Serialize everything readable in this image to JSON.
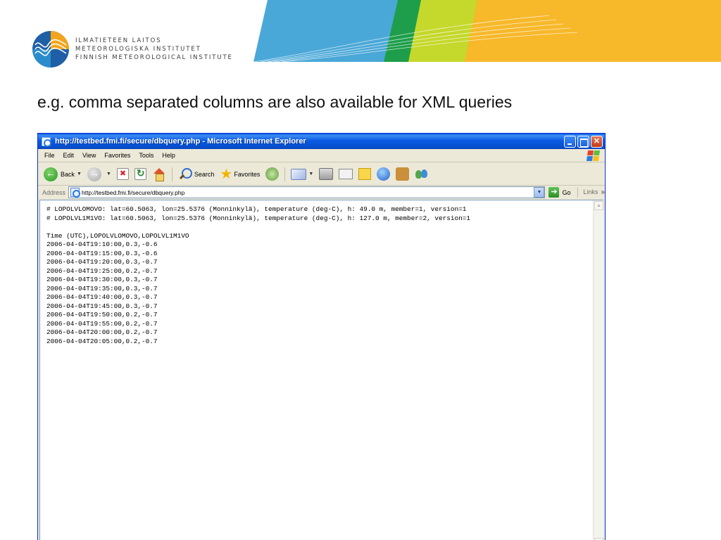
{
  "slide": {
    "org_lines": [
      "ILMATIETEEN LAITOS",
      "METEOROLOGISKA INSTITUTET",
      "FINNISH METEOROLOGICAL INSTITUTE"
    ],
    "title": "e.g. comma separated columns are also available for XML queries",
    "banner_colors": [
      "#4aa8d8",
      "#1e9e4a",
      "#c5d82c",
      "#f7b82a"
    ]
  },
  "browser": {
    "window_title": "http://testbed.fmi.fi/secure/dbquery.php - Microsoft Internet Explorer",
    "menu": [
      "File",
      "Edit",
      "View",
      "Favorites",
      "Tools",
      "Help"
    ],
    "toolbar": {
      "back_label": "Back",
      "search_label": "Search",
      "favorites_label": "Favorites"
    },
    "address": {
      "label": "Address",
      "url": "http://testbed.fmi.fi/secure/dbquery.php",
      "go_label": "Go",
      "links_label": "Links"
    },
    "content": {
      "header_lines": [
        "# LOPOLVLOMOVO: lat=60.5063, lon=25.5376 (Monninkylä), temperature (deg-C), h: 49.0 m, member=1, version=1",
        "# LOPOLVL1M1VO: lat=60.5063, lon=25.5376 (Monninkylä), temperature (deg-C), h: 127.0 m, member=2, version=1"
      ],
      "column_header": "Time (UTC),LOPOLVLOMOVO,LOPOLVL1M1VO",
      "rows": [
        "2006-04-04T19:10:00,0.3,-0.6",
        "2006-04-04T19:15:00,0.3,-0.6",
        "2006-04-04T19:20:00,0.3,-0.7",
        "2006-04-04T19:25:00,0.2,-0.7",
        "2006-04-04T19:30:00,0.3,-0.7",
        "2006-04-04T19:35:00,0.3,-0.7",
        "2006-04-04T19:40:00,0.3,-0.7",
        "2006-04-04T19:45:00,0.3,-0.7",
        "2006-04-04T19:50:00,0.2,-0.7",
        "2006-04-04T19:55:00,0.2,-0.7",
        "2006-04-04T20:00:00,0.2,-0.7",
        "2006-04-04T20:05:00,0.2,-0.7"
      ]
    }
  }
}
